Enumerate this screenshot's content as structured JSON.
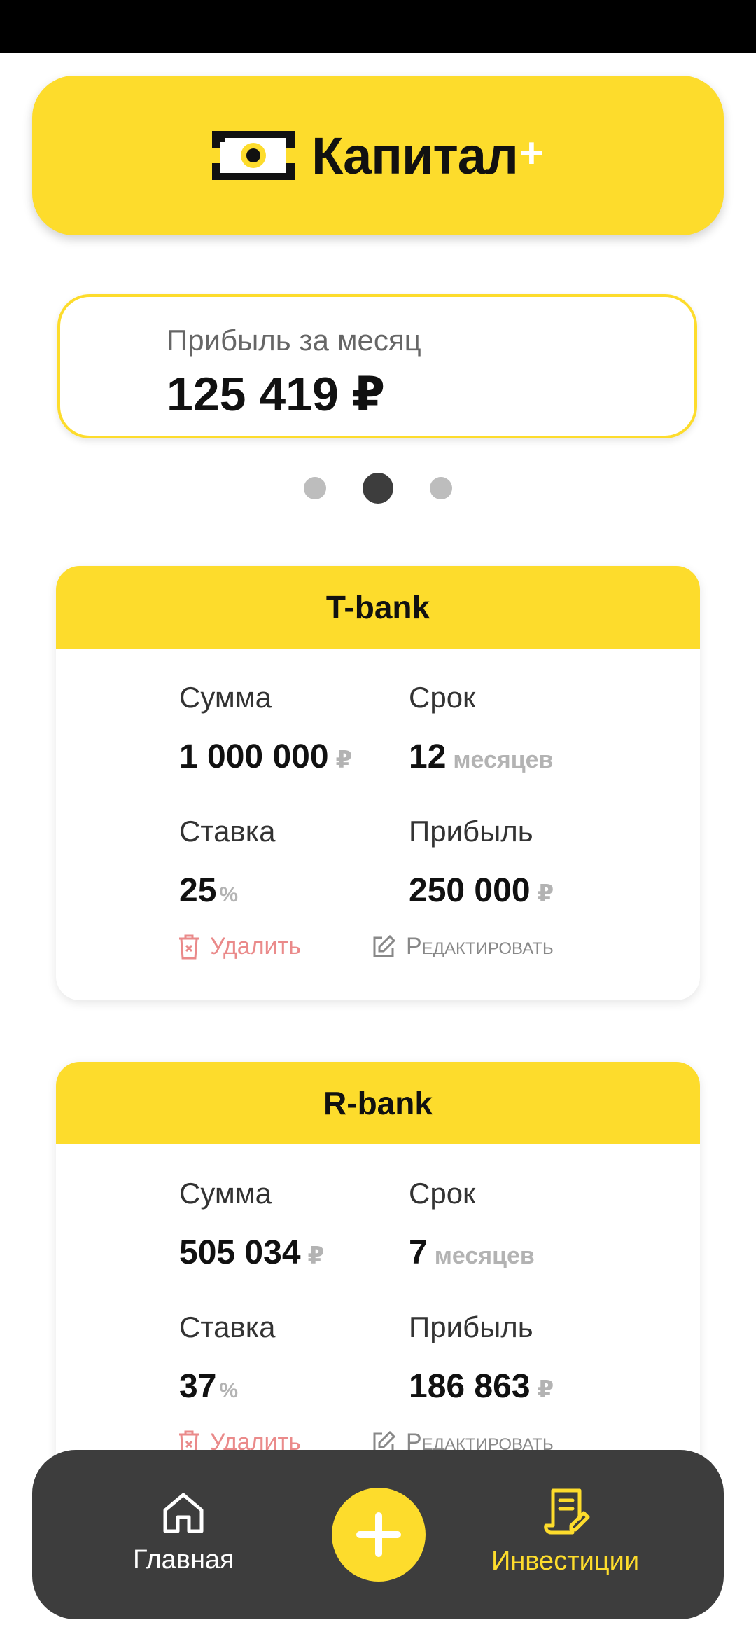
{
  "app": {
    "title": "Капитал",
    "title_plus": "+"
  },
  "profit": {
    "label": "Прибыль за месяц",
    "value": "125 419 ₽"
  },
  "carousel": {
    "count": 3,
    "active_index": 1
  },
  "colors": {
    "accent": "#FDDC2C",
    "nav_bg": "#3d3d3d",
    "delete": "#ea8a8a"
  },
  "investments": [
    {
      "bank": "T-bank",
      "sum_label": "Сумма",
      "sum_value": "1 000 000",
      "sum_unit": "₽",
      "term_label": "Срок",
      "term_value": "12",
      "term_unit": "месяцев",
      "rate_label": "Ставка",
      "rate_value": "25",
      "rate_unit": "%",
      "profit_label": "Прибыль",
      "profit_value": "250 000",
      "profit_unit": "₽",
      "delete_label": "Удалить",
      "edit_label": "Редактировать"
    },
    {
      "bank": "R-bank",
      "sum_label": "Сумма",
      "sum_value": "505 034",
      "sum_unit": "₽",
      "term_label": "Срок",
      "term_value": "7",
      "term_unit": "месяцев",
      "rate_label": "Ставка",
      "rate_value": "37",
      "rate_unit": "%",
      "profit_label": "Прибыль",
      "profit_value": "186 863",
      "profit_unit": "₽",
      "delete_label": "Удалить",
      "edit_label": "Редактировать"
    }
  ],
  "nav": {
    "home_label": "Главная",
    "home_icon": "home-icon",
    "add_icon": "plus-icon",
    "invest_label": "Инвестиции",
    "invest_icon": "document-edit-icon"
  }
}
